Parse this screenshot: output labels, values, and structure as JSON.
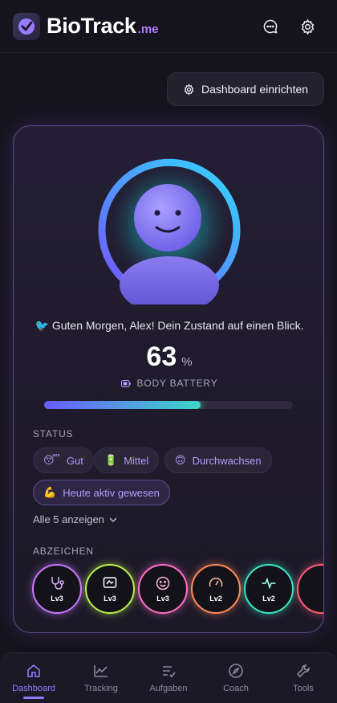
{
  "app": {
    "title": "BioTrack",
    "suffix": ".me"
  },
  "header": {
    "chat_icon": "chat-bubble-icon",
    "settings_icon": "gear-icon"
  },
  "dashboard_button": {
    "label": "Dashboard einrichten",
    "icon": "gear-icon"
  },
  "card": {
    "greeting": "🐦 Guten Morgen, Alex! Dein Zustand auf einen Blick.",
    "battery": {
      "value": "63",
      "unit": "%",
      "label": "BODY BATTERY",
      "progress": 0.63
    },
    "status": {
      "title": "STATUS",
      "chips": [
        {
          "emoji": "😴",
          "label": "Gut"
        },
        {
          "emoji": "🔋",
          "label": "Mittel"
        },
        {
          "emoji": "🙃",
          "label": "Durchwachsen"
        },
        {
          "emoji": "💪",
          "label": "Heute aktiv gewesen"
        }
      ],
      "show_all": "Alle 5 anzeigen"
    },
    "badges": {
      "title": "ABZEICHEN",
      "items": [
        {
          "icon": "stethoscope-icon",
          "level": "Lv3",
          "color": "#c878ff"
        },
        {
          "icon": "monitor-icon",
          "level": "Lv3",
          "color": "#b8f04a"
        },
        {
          "icon": "smile-icon",
          "level": "Lv3",
          "color": "#ff6fc8"
        },
        {
          "icon": "gauge-icon",
          "level": "Lv2",
          "color": "#ff8a5c"
        },
        {
          "icon": "activity-icon",
          "level": "Lv2",
          "color": "#3ce6c4"
        }
      ]
    }
  },
  "nav": {
    "items": [
      {
        "label": "Dashboard",
        "icon": "home-icon"
      },
      {
        "label": "Tracking",
        "icon": "trend-icon"
      },
      {
        "label": "Aufgaben",
        "icon": "tasks-icon"
      },
      {
        "label": "Coach",
        "icon": "compass-icon"
      },
      {
        "label": "Tools",
        "icon": "wrench-icon"
      }
    ],
    "active": "Dashboard"
  }
}
